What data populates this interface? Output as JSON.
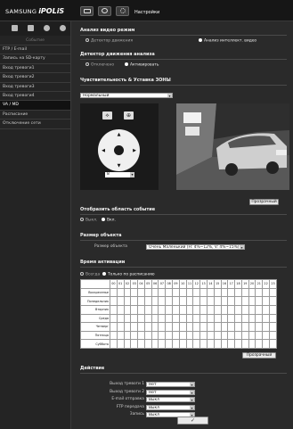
{
  "brand": {
    "samsung": "SAMSUNG",
    "ipolis": "iPOLiS"
  },
  "header": {
    "tab_settings": "Настройки"
  },
  "sidebar": {
    "title": "Событие",
    "items": [
      {
        "label": "FTP / E-mail",
        "selected": false
      },
      {
        "label": "Запись на SD-карту",
        "selected": false
      },
      {
        "label": "Вход тревоги1",
        "selected": false
      },
      {
        "label": "Вход тревоги2",
        "selected": false
      },
      {
        "label": "Вход тревоги3",
        "selected": false
      },
      {
        "label": "Вход тревоги4",
        "selected": false
      },
      {
        "label": "VA / MD",
        "selected": true
      },
      {
        "label": "Расписание",
        "selected": false
      },
      {
        "label": "Отключение сети",
        "selected": false
      }
    ]
  },
  "mode": {
    "title": "Анализ видео режим",
    "option1": "Детектор движения",
    "option2": "Анализ интеллект. видео",
    "selected": "option2"
  },
  "detector": {
    "title": "Детектор движения анализа",
    "off": "Отключено",
    "on": "Активировать",
    "selected": "on"
  },
  "sensitivity": {
    "title": "Чувствительность & Уставка ЗОНЫ",
    "level": "Нормальный",
    "zoom_out": "⟡",
    "zoom_in": "⊕",
    "step_value": "8",
    "transparent_button": "Прозрачный"
  },
  "display_area": {
    "title": "Отобразить область событие",
    "off": "Выкл.",
    "on": "Вкл.",
    "selected": "on"
  },
  "object_size": {
    "title": "Размер объекта",
    "label": "Размер объекта",
    "value": "Очень Маленький (Н: 4%~12%, V: 4%~15%)"
  },
  "activation": {
    "title": "Время активации",
    "always": "Всегда",
    "scheduled": "Только по расписанию",
    "selected": "scheduled",
    "hours": [
      "00",
      "01",
      "02",
      "03",
      "04",
      "05",
      "06",
      "07",
      "08",
      "09",
      "10",
      "11",
      "12",
      "13",
      "14",
      "15",
      "16",
      "17",
      "18",
      "19",
      "20",
      "21",
      "22",
      "23"
    ],
    "days": [
      "Воскресенье",
      "Понедельник",
      "Вторник",
      "Среда",
      "Четверг",
      "Пятница",
      "Суббота"
    ],
    "transparent_button": "Прозрачный"
  },
  "actions": {
    "title": "Действие",
    "rows": [
      {
        "label": "Выход тревоги 1",
        "value": "Нет"
      },
      {
        "label": "Выход тревоги 2",
        "value": "Нет"
      },
      {
        "label": "E-mail отправка",
        "value": "Выкл"
      },
      {
        "label": "FTP передача",
        "value": "Выкл"
      },
      {
        "label": "Запись",
        "value": "Выкл"
      }
    ]
  },
  "apply_button": "✓",
  "colors": {
    "background": "#2a2a2a",
    "sidebar": "#242424",
    "topbar": "#161616",
    "selected": "#111111"
  }
}
